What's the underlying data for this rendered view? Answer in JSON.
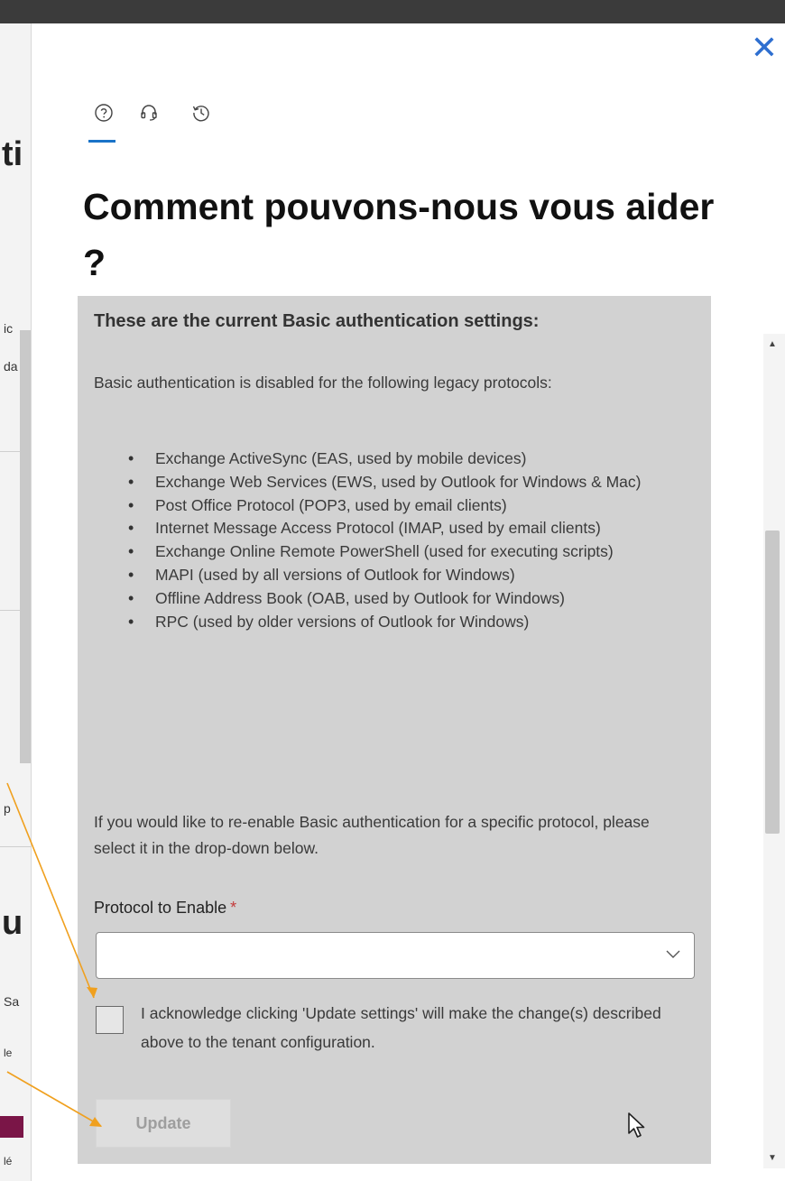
{
  "background_page": {
    "fragments": [
      "ti",
      "ic",
      "da",
      "p",
      "u",
      "Sa",
      "le",
      "lé"
    ]
  },
  "panel": {
    "close_icon": "close-icon",
    "tabs": [
      {
        "icon": "help-circle-icon"
      },
      {
        "icon": "headset-icon"
      },
      {
        "icon": "history-icon"
      }
    ],
    "heading": "Comment pouvons-nous vous aider ?"
  },
  "settings": {
    "title": "These are the current Basic authentication settings:",
    "intro": "Basic authentication is disabled for the following legacy protocols:",
    "protocols": [
      "Exchange ActiveSync (EAS, used by mobile devices)",
      "Exchange Web Services (EWS, used by Outlook for Windows & Mac)",
      "Post Office Protocol (POP3, used by email clients)",
      "Internet Message Access Protocol (IMAP, used by email clients)",
      "Exchange Online Remote PowerShell (used for executing scripts)",
      "MAPI (used by all versions of Outlook for Windows)",
      "Offline Address Book (OAB, used by Outlook for Windows)",
      "RPC (used by older versions of Outlook for Windows)"
    ],
    "reenable": "If you would like to re-enable Basic authentication for a specific protocol, please select it in the drop-down below.",
    "protocol_label": "Protocol to Enable",
    "required_mark": "*",
    "protocol_value": "",
    "acknowledge": "I acknowledge clicking 'Update settings' will make the change(s) described above to the tenant configuration.",
    "acknowledge_checked": false,
    "update_button": "Update",
    "update_disabled": true
  },
  "colors": {
    "accent": "#1a73c8",
    "close": "#2e6fd0",
    "annotation_arrow": "#f0a01e",
    "required": "#c43b3b",
    "content_bg": "#d2d2d2"
  }
}
